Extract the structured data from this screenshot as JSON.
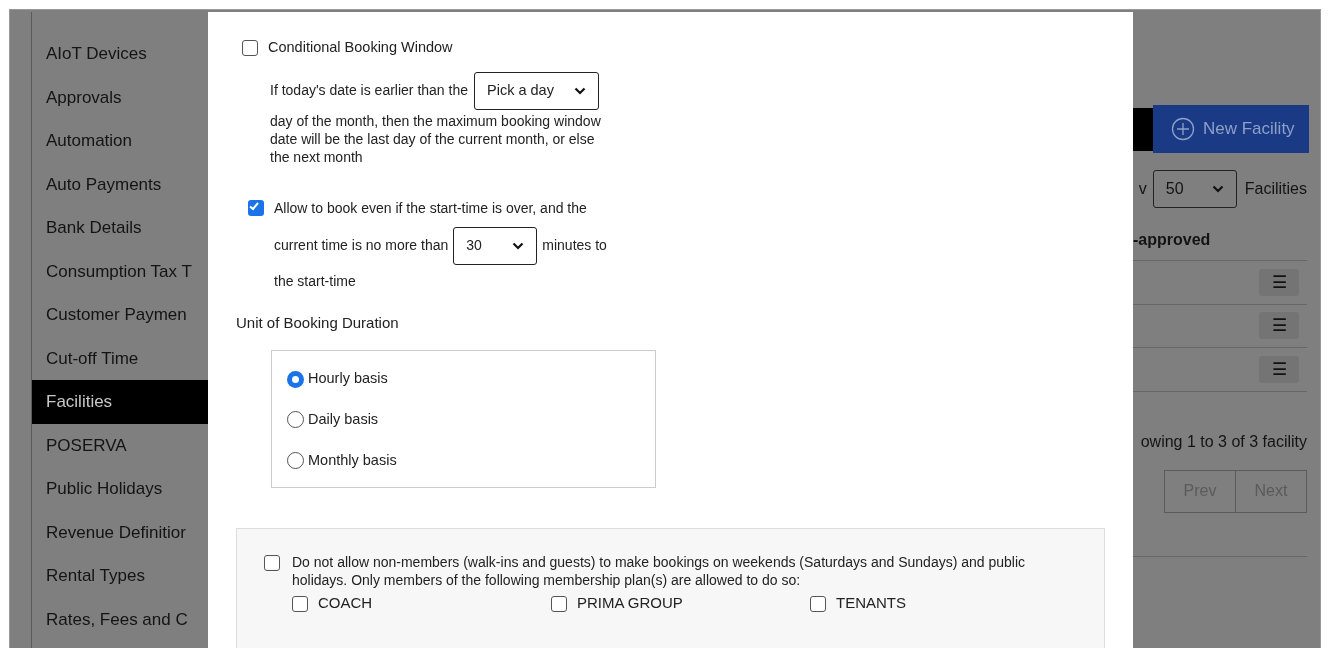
{
  "sidebar": {
    "items": [
      {
        "label": "AIoT Devices",
        "selected": false
      },
      {
        "label": "Approvals",
        "selected": false
      },
      {
        "label": "Automation",
        "selected": false
      },
      {
        "label": "Auto Payments",
        "selected": false
      },
      {
        "label": "Bank Details",
        "selected": false
      },
      {
        "label": "Consumption Tax T",
        "selected": false
      },
      {
        "label": "Customer Paymen",
        "selected": false
      },
      {
        "label": "Cut-off Time",
        "selected": false
      },
      {
        "label": "Facilities",
        "selected": true
      },
      {
        "label": "POSERVA",
        "selected": false
      },
      {
        "label": "Public Holidays",
        "selected": false
      },
      {
        "label": "Revenue Definitior",
        "selected": false
      },
      {
        "label": "Rental Types",
        "selected": false
      },
      {
        "label": "Rates, Fees and C",
        "selected": false
      }
    ]
  },
  "page": {
    "new_facility_button": "New Facility",
    "show_prefix": "v",
    "show_select": "50",
    "show_suffix": "Facilities",
    "column_header": "-approved",
    "rows": [
      {
        "menu": "☰"
      },
      {
        "menu": "☰"
      },
      {
        "menu": "☰"
      }
    ],
    "pagination_info": "owing 1 to 3 of 3 facility",
    "pagination_buttons": [
      "Prev",
      "Next"
    ]
  },
  "modal": {
    "conditional_booking": {
      "label": "Conditional Booking Window",
      "checked": false,
      "text_before": "If today's date is earlier than the",
      "select": "Pick a day",
      "text_after": "day of the month, then the maximum booking window date will be the last day of the current month, or else the next month"
    },
    "late_booking": {
      "checked": true,
      "text": "Allow to book even if the start-time is over, and the",
      "text_before_select": "current time is no more than",
      "select": "30",
      "text_after_select": "minutes to",
      "text_end": "the start-time"
    },
    "duration_unit": {
      "title": "Unit of Booking Duration",
      "options": [
        {
          "label": "Hourly basis",
          "selected": true
        },
        {
          "label": "Daily basis",
          "selected": false
        },
        {
          "label": "Monthly basis",
          "selected": false
        }
      ]
    },
    "weekend_restriction": {
      "checked": false,
      "text": "Do not allow non-members (walk-ins and guests) to make bookings on weekends (Saturdays and Sundays) and public holidays. Only members of the following membership plan(s) are allowed to do so:",
      "plans": [
        {
          "label": "COACH",
          "checked": false
        },
        {
          "label": "PRIMA GROUP",
          "checked": false
        },
        {
          "label": "TENANTS",
          "checked": false
        }
      ]
    }
  }
}
